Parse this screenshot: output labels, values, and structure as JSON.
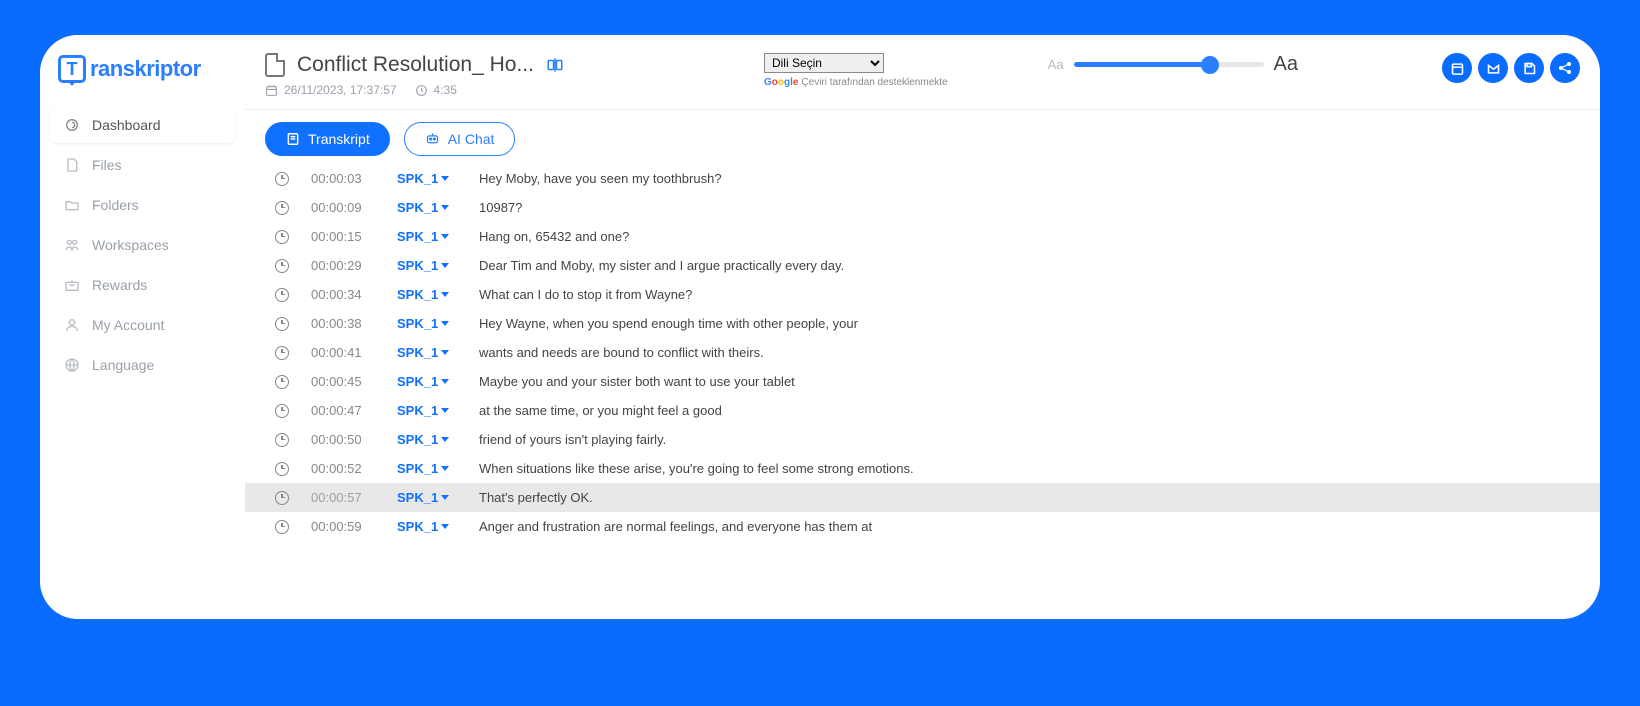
{
  "brand": "ranskriptor",
  "sidebar": {
    "items": [
      {
        "label": "Dashboard",
        "active": true
      },
      {
        "label": "Files",
        "active": false
      },
      {
        "label": "Folders",
        "active": false
      },
      {
        "label": "Workspaces",
        "active": false
      },
      {
        "label": "Rewards",
        "active": false
      },
      {
        "label": "My Account",
        "active": false
      },
      {
        "label": "Language",
        "active": false
      }
    ]
  },
  "header": {
    "title": "Conflict Resolution_ Ho...",
    "datetime": "26/11/2023, 17:37:57",
    "duration": "4:35",
    "lang_select": "Dili Seçin",
    "google_translate_credit": "Çeviri tarafından desteklenmekte",
    "font_small": "Aa",
    "font_large": "Aa",
    "font_percent": 72
  },
  "tabs": {
    "transcript": "Transkript",
    "ai_chat": "AI Chat"
  },
  "rows": [
    {
      "time": "00:00:03",
      "speaker": "SPK_1",
      "text": "Hey Moby, have you seen my toothbrush?",
      "hl": false
    },
    {
      "time": "00:00:09",
      "speaker": "SPK_1",
      "text": "10987?",
      "hl": false
    },
    {
      "time": "00:00:15",
      "speaker": "SPK_1",
      "text": "Hang on, 65432 and one?",
      "hl": false
    },
    {
      "time": "00:00:29",
      "speaker": "SPK_1",
      "text": "Dear Tim and Moby, my sister and I argue practically every day.",
      "hl": false
    },
    {
      "time": "00:00:34",
      "speaker": "SPK_1",
      "text": "What can I do to stop it from Wayne?",
      "hl": false
    },
    {
      "time": "00:00:38",
      "speaker": "SPK_1",
      "text": "Hey Wayne, when you spend enough time with other people, your",
      "hl": false
    },
    {
      "time": "00:00:41",
      "speaker": "SPK_1",
      "text": "wants and needs are bound to conflict with theirs.",
      "hl": false
    },
    {
      "time": "00:00:45",
      "speaker": "SPK_1",
      "text": "Maybe you and your sister both want to use your tablet",
      "hl": false
    },
    {
      "time": "00:00:47",
      "speaker": "SPK_1",
      "text": "at the same time, or you might feel a good",
      "hl": false
    },
    {
      "time": "00:00:50",
      "speaker": "SPK_1",
      "text": "friend of yours isn't playing fairly.",
      "hl": false
    },
    {
      "time": "00:00:52",
      "speaker": "SPK_1",
      "text": "When situations like these arise, you're going to feel some strong emotions.",
      "hl": false
    },
    {
      "time": "00:00:57",
      "speaker": "SPK_1",
      "text": "That's perfectly OK.",
      "hl": true
    },
    {
      "time": "00:00:59",
      "speaker": "SPK_1",
      "text": "Anger and frustration are normal feelings, and everyone has them at",
      "hl": false
    }
  ]
}
